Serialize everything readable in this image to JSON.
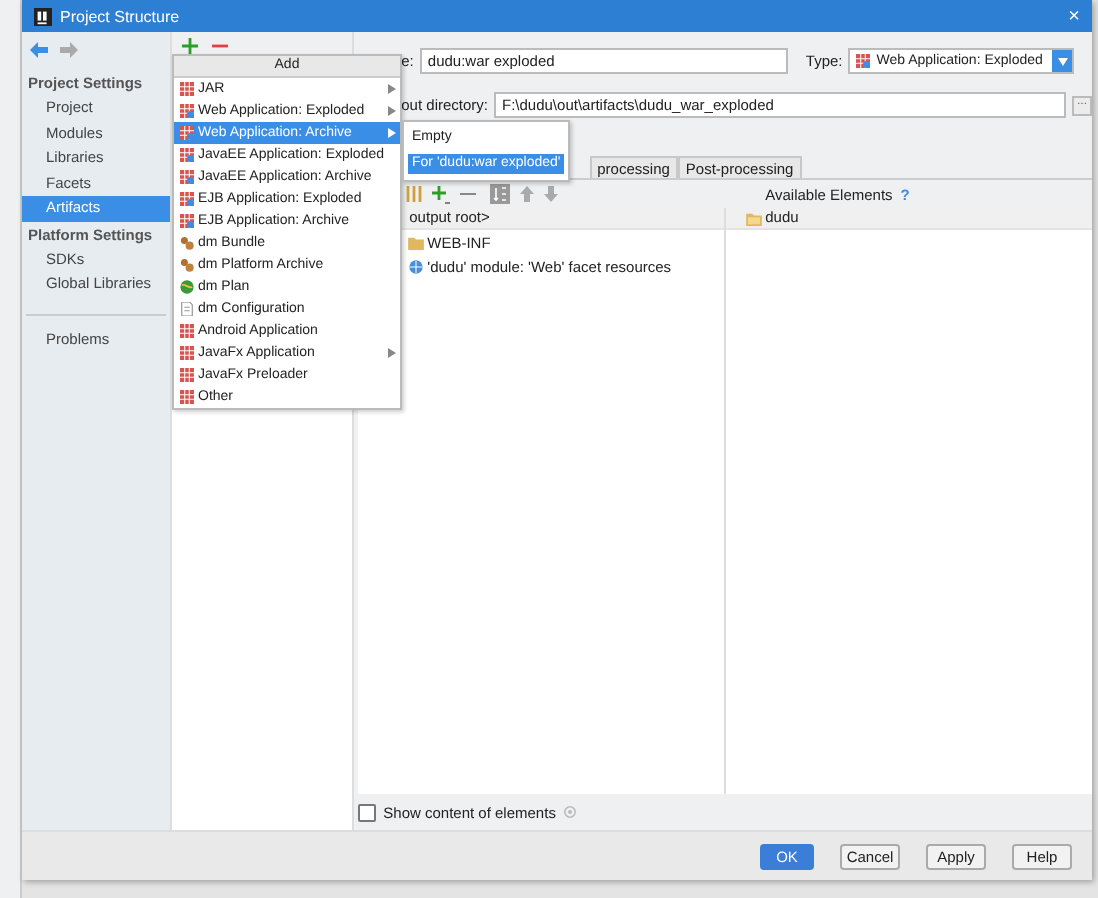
{
  "window": {
    "title": "Project Structure",
    "close": "×"
  },
  "sidebar": {
    "groups": [
      {
        "header": "Project Settings",
        "items": [
          {
            "label": "Project",
            "selected": false
          },
          {
            "label": "Modules",
            "selected": false
          },
          {
            "label": "Libraries",
            "selected": false
          },
          {
            "label": "Facets",
            "selected": false
          },
          {
            "label": "Artifacts",
            "selected": true
          }
        ]
      },
      {
        "header": "Platform Settings",
        "items": [
          {
            "label": "SDKs",
            "selected": false
          },
          {
            "label": "Global Libraries",
            "selected": false
          }
        ]
      },
      {
        "items": [
          {
            "label": "Problems",
            "selected": false
          }
        ]
      }
    ]
  },
  "add_menu": {
    "title": "Add",
    "items": [
      {
        "label": "JAR",
        "kind": "jar",
        "submenu": true,
        "selected": false
      },
      {
        "label": "Web Application: Exploded",
        "kind": "web",
        "submenu": true,
        "selected": false
      },
      {
        "label": "Web Application: Archive",
        "kind": "web",
        "submenu": true,
        "selected": true
      },
      {
        "label": "JavaEE Application: Exploded",
        "kind": "web",
        "submenu": false,
        "selected": false
      },
      {
        "label": "JavaEE Application: Archive",
        "kind": "web",
        "submenu": false,
        "selected": false
      },
      {
        "label": "EJB Application: Exploded",
        "kind": "web",
        "submenu": false,
        "selected": false
      },
      {
        "label": "EJB Application: Archive",
        "kind": "web",
        "submenu": false,
        "selected": false
      },
      {
        "label": "dm Bundle",
        "kind": "bundle",
        "submenu": false,
        "selected": false
      },
      {
        "label": "dm Platform Archive",
        "kind": "bundle",
        "submenu": false,
        "selected": false
      },
      {
        "label": "dm Plan",
        "kind": "plan",
        "submenu": false,
        "selected": false
      },
      {
        "label": "dm Configuration",
        "kind": "config",
        "submenu": false,
        "selected": false
      },
      {
        "label": "Android Application",
        "kind": "jar",
        "submenu": false,
        "selected": false
      },
      {
        "label": "JavaFx Application",
        "kind": "jar",
        "submenu": true,
        "selected": false
      },
      {
        "label": "JavaFx Preloader",
        "kind": "jar",
        "submenu": false,
        "selected": false
      },
      {
        "label": "Other",
        "kind": "jar",
        "submenu": false,
        "selected": false
      }
    ]
  },
  "submenu": {
    "items": [
      {
        "label": "Empty",
        "selected": false
      },
      {
        "label": "For 'dudu:war exploded'",
        "selected": true
      }
    ]
  },
  "name_field": {
    "label": "e:",
    "value": "dudu:war exploded"
  },
  "type_field": {
    "label": "Type:",
    "value": "Web Application: Exploded"
  },
  "output_directory": {
    "label": "out directory:",
    "value": "F:\\dudu\\out\\artifacts\\dudu_war_exploded",
    "browse": "..."
  },
  "tabs": [
    {
      "label": "processing",
      "selected": false
    },
    {
      "label": "Post-processing",
      "selected": false
    }
  ],
  "output_tree": {
    "header": "output root>",
    "items": [
      {
        "label": "WEB-INF",
        "kind": "folder"
      },
      {
        "label": "'dudu' module: 'Web' facet resources",
        "kind": "module"
      }
    ]
  },
  "available": {
    "title": "Available Elements",
    "help": "?",
    "items": [
      {
        "label": "dudu"
      }
    ]
  },
  "show_content": {
    "label": "Show content of elements",
    "checked": false
  },
  "buttons": [
    {
      "label": "OK",
      "kind": "primary"
    },
    {
      "label": "Cancel",
      "kind": "normal"
    },
    {
      "label": "Apply",
      "kind": "normal"
    },
    {
      "label": "Help",
      "kind": "normal"
    }
  ]
}
